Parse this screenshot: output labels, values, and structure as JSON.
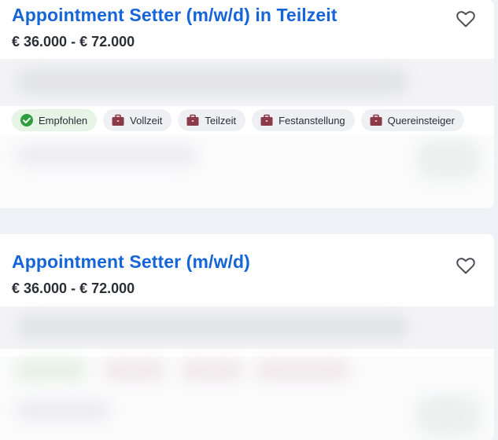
{
  "colors": {
    "title": "#1565d8",
    "recommended_check": "#2e9e3e",
    "briefcase": "#8b3a4a"
  },
  "jobs": [
    {
      "title": "Appointment Setter (m/w/d) in Teilzeit",
      "salary": "€ 36.000 - € 72.000",
      "favorite_icon": "heart-outline-icon",
      "tags": [
        {
          "label": "Empfohlen",
          "icon": "check-circle-icon"
        },
        {
          "label": "Vollzeit",
          "icon": "briefcase-icon"
        },
        {
          "label": "Teilzeit",
          "icon": "briefcase-icon"
        },
        {
          "label": "Festanstellung",
          "icon": "briefcase-icon"
        },
        {
          "label": "Quereinsteiger",
          "icon": "briefcase-icon"
        }
      ]
    },
    {
      "title": "Appointment Setter (m/w/d)",
      "salary": "€ 36.000 - € 72.000",
      "favorite_icon": "heart-outline-icon"
    }
  ]
}
